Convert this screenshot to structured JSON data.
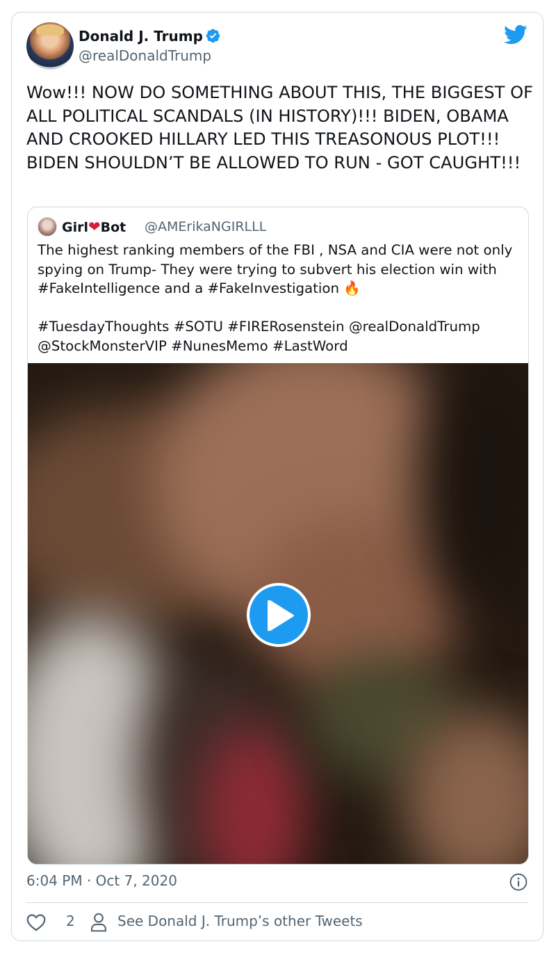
{
  "tweet": {
    "author_name": "Donald J. Trump",
    "author_handle": "@realDonaldTrump",
    "text": "Wow!!! NOW DO SOMETHING ABOUT THIS, THE BIGGEST OF ALL POLITICAL SCANDALS (IN HISTORY)!!! BIDEN, OBAMA AND CROOKED HILLARY LED THIS TREASONOUS PLOT!!! BIDEN SHOULDN’T BE ALLOWED TO RUN - GOT CAUGHT!!!",
    "timestamp": "6:04 PM · Oct 7, 2020",
    "like_count": "2",
    "other_tweets_link": "See Donald J. Trump’s other Tweets"
  },
  "quoted": {
    "name_part1": "Girl",
    "name_heart": "❤",
    "name_part2": "Bot",
    "handle": "@AMErikaNGIRLLL",
    "text": "The highest ranking members of the FBI , NSA and CIA were not only spying on Trump- They were trying to subvert his election win with #FakeIntelligence and a #FakeInvestigation",
    "fire_emoji": "🔥",
    "hashtags": "#TuesdayThoughts #SOTU #FIRERosenstein  @realDonaldTrump @StockMonsterVIP #NunesMemo #LastWord"
  },
  "icons": {
    "verified": "verified-badge-icon",
    "brand": "twitter-bird-icon",
    "play": "play-icon",
    "info": "info-icon",
    "like": "heart-outline-icon",
    "profile": "person-icon"
  },
  "colors": {
    "accent": "#1d9bf0",
    "text": "#0f1419",
    "secondary": "#536471",
    "border": "#cfd9de",
    "heart": "#d0213a"
  }
}
